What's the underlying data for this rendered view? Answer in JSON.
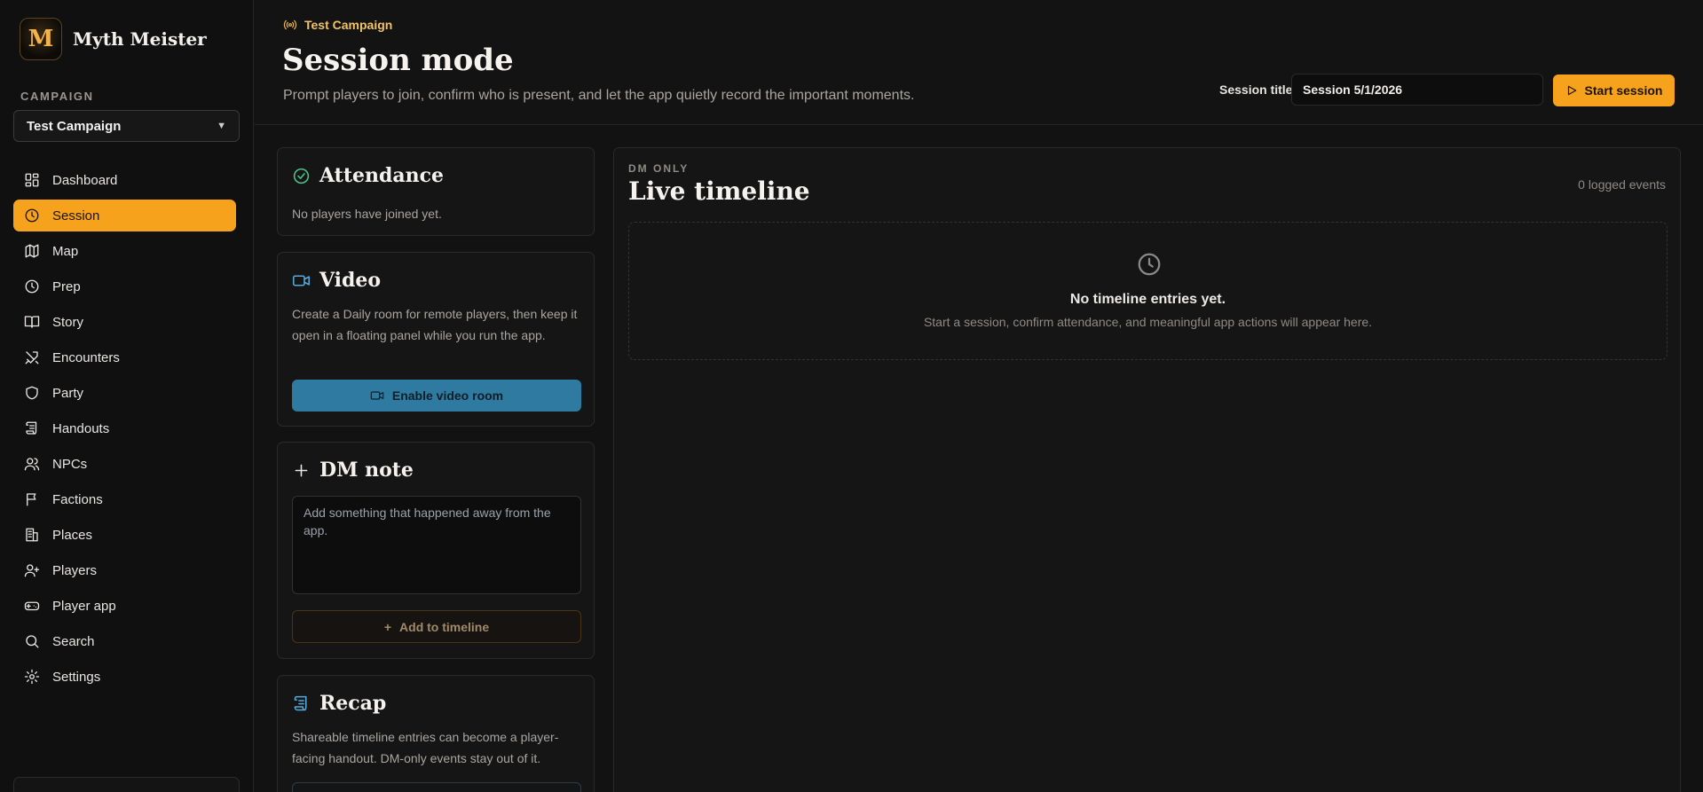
{
  "brand": {
    "name": "Myth Meister",
    "logo_letter": "M"
  },
  "campaign": {
    "label": "CAMPAIGN",
    "selected": "Test Campaign"
  },
  "nav": [
    {
      "label": "Dashboard",
      "icon": "dashboard-icon",
      "active": false
    },
    {
      "label": "Session",
      "icon": "clock-icon",
      "active": true
    },
    {
      "label": "Map",
      "icon": "map-icon",
      "active": false
    },
    {
      "label": "Prep",
      "icon": "clock-icon",
      "active": false
    },
    {
      "label": "Story",
      "icon": "book-icon",
      "active": false
    },
    {
      "label": "Encounters",
      "icon": "swords-icon",
      "active": false
    },
    {
      "label": "Party",
      "icon": "shield-icon",
      "active": false
    },
    {
      "label": "Handouts",
      "icon": "scroll-icon",
      "active": false
    },
    {
      "label": "NPCs",
      "icon": "users-icon",
      "active": false
    },
    {
      "label": "Factions",
      "icon": "flag-icon",
      "active": false
    },
    {
      "label": "Places",
      "icon": "building-icon",
      "active": false
    },
    {
      "label": "Players",
      "icon": "user-plus-icon",
      "active": false
    },
    {
      "label": "Player app",
      "icon": "gamepad-icon",
      "active": false
    },
    {
      "label": "Search",
      "icon": "search-icon",
      "active": false
    },
    {
      "label": "Settings",
      "icon": "gear-icon",
      "active": false
    }
  ],
  "header": {
    "eyebrow": "Test Campaign",
    "title": "Session mode",
    "subtitle": "Prompt players to join, confirm who is present, and let the app quietly record the important moments.",
    "session_title_label": "Session title",
    "session_title_value": "Session 5/1/2026",
    "start_label": "Start session"
  },
  "attendance": {
    "title": "Attendance",
    "empty": "No players have joined yet."
  },
  "video": {
    "title": "Video",
    "description": "Create a Daily room for remote players, then keep it open in a floating panel while you run the app.",
    "button": "Enable video room"
  },
  "dm_note": {
    "title": "DM note",
    "placeholder": "Add something that happened away from the app.",
    "button": "Add to timeline"
  },
  "recap": {
    "title": "Recap",
    "description": "Shareable timeline entries can become a player-facing handout. DM-only events stay out of it."
  },
  "timeline": {
    "eyebrow": "DM ONLY",
    "title": "Live timeline",
    "count": "0 logged events",
    "empty_title": "No timeline entries yet.",
    "empty_sub": "Start a session, confirm attendance, and meaningful app actions will appear here."
  },
  "colors": {
    "accent": "#f6a21c",
    "video": "#2e7aa0",
    "background": "#121212"
  }
}
